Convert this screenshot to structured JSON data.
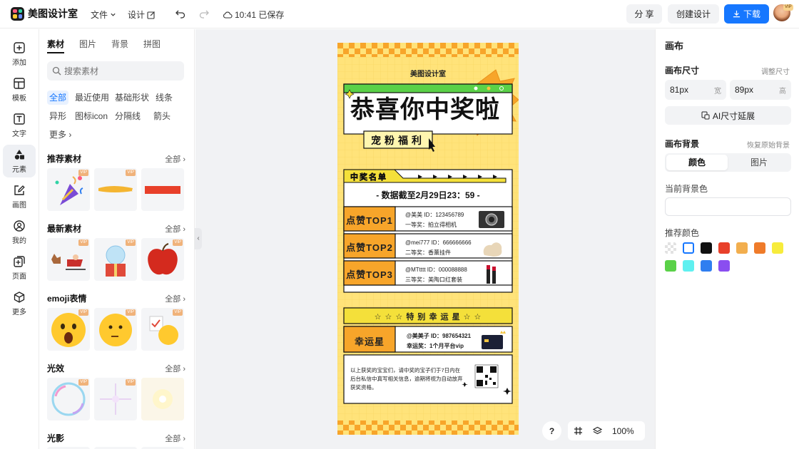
{
  "topbar": {
    "app_name": "美图设计室",
    "file_menu": "文件",
    "design_menu": "设计",
    "save_status": "10:41 已保存",
    "share_label": "分 享",
    "create_label": "创建设计",
    "download_label": "下载",
    "avatar_badge": "VIP"
  },
  "leftnav": {
    "items": [
      {
        "label": "添加",
        "icon": "plus-square-icon"
      },
      {
        "label": "模板",
        "icon": "template-icon"
      },
      {
        "label": "文字",
        "icon": "text-icon"
      },
      {
        "label": "元素",
        "icon": "shapes-icon"
      },
      {
        "label": "画图",
        "icon": "draw-icon"
      },
      {
        "label": "我的",
        "icon": "user-icon"
      },
      {
        "label": "页面",
        "icon": "page-add-icon"
      },
      {
        "label": "更多",
        "icon": "cube-icon"
      }
    ],
    "active": "元素"
  },
  "panel": {
    "tabs": [
      "素材",
      "图片",
      "背景",
      "拼图"
    ],
    "search_placeholder": "搜索素材",
    "chips": [
      "全部",
      "最近使用",
      "基础形状",
      "线条",
      "异形",
      "图标icon",
      "分隔线",
      "箭头",
      "更多"
    ],
    "sections": [
      {
        "title": "推荐素材",
        "all": "全部"
      },
      {
        "title": "最新素材",
        "all": "全部"
      },
      {
        "title": "emoji表情",
        "all": "全部"
      },
      {
        "title": "光效",
        "all": "全部"
      },
      {
        "title": "光影",
        "all": "全部"
      }
    ],
    "vip_badge": "VIP"
  },
  "poster": {
    "brand": "美图设计室",
    "headline": "恭喜你中奖啦",
    "subtitle": "宠粉福利",
    "list_tag": "中奖名单",
    "deadline": "- 数据截至2月29日23：59 -",
    "winners": [
      {
        "rank": "点赞TOP1",
        "user": "@美美 ID：123456789",
        "prize": "一等奖：拍立得相机"
      },
      {
        "rank": "点赞TOP2",
        "user": "@mei777 ID：666666666",
        "prize": "二等奖：香薰挂件"
      },
      {
        "rank": "点赞TOP3",
        "user": "@MTtttt ID：000088888",
        "prize": "三等奖：美陶口红套装"
      }
    ],
    "special_title": "特 别 幸 运 星",
    "lucky_rank": "幸运星",
    "lucky_user": "@美美子 ID：987654321",
    "lucky_prize": "幸运奖：1个月平台vip",
    "notice": "以上获奖的宝宝们，请中奖的宝子们于7日内在后台私信中真写相关信息，逾期将视为自动放弃获奖资格。"
  },
  "rpanel": {
    "title": "画布",
    "size_label": "画布尺寸",
    "size_adjust": "调整尺寸",
    "width_value": "81px",
    "width_unit": "宽",
    "height_value": "89px",
    "height_unit": "高",
    "ai_extend": "AI尺寸延展",
    "bg_label": "画布背景",
    "bg_restore": "恢复原始背景",
    "seg_color": "颜色",
    "seg_image": "图片",
    "current_bg": "当前背景色",
    "recommend": "推荐颜色",
    "colors": [
      "transparent",
      "#ffffff",
      "#111111",
      "#e8402a",
      "#f2ae4e",
      "#ef7b2a",
      "#f7ec3c",
      "#5ad148",
      "#5ff0f0",
      "#2f7ef0",
      "#8a4ef0"
    ]
  },
  "bottom": {
    "help": "?",
    "zoom": "100%"
  }
}
